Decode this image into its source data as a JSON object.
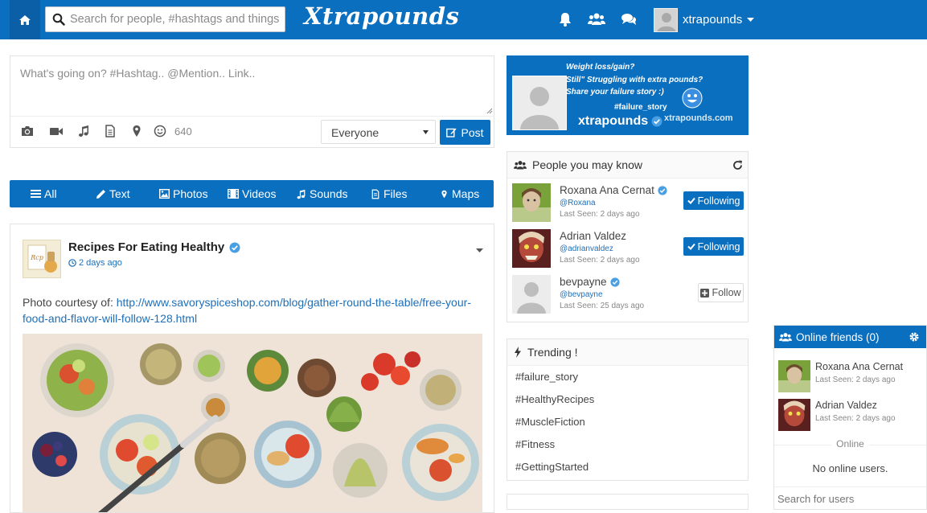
{
  "header": {
    "logo": "Xtrapounds",
    "search_placeholder": "Search for people, #hashtags and things",
    "username": "xtrapounds",
    "icons": [
      "home-icon",
      "search-icon",
      "bell-icon",
      "users-icon",
      "comments-icon",
      "caret-down-icon"
    ]
  },
  "composer": {
    "placeholder": "What's going on? #Hashtag.. @Mention.. Link..",
    "char_count": "640",
    "privacy": "Everyone",
    "post_label": "Post",
    "tools": [
      "camera-icon",
      "video-icon",
      "music-icon",
      "file-icon",
      "map-marker-icon",
      "smiley-icon"
    ]
  },
  "filters": [
    {
      "label": "All",
      "icon": "list-icon"
    },
    {
      "label": "Text",
      "icon": "pencil-icon"
    },
    {
      "label": "Photos",
      "icon": "picture-icon"
    },
    {
      "label": "Videos",
      "icon": "film-icon"
    },
    {
      "label": "Sounds",
      "icon": "music-icon"
    },
    {
      "label": "Files",
      "icon": "file-icon"
    },
    {
      "label": "Maps",
      "icon": "map-marker-icon"
    }
  ],
  "post": {
    "author": "Recipes For Eating Healthy",
    "time": "2 days ago",
    "text_prefix": "Photo courtesy of: ",
    "link": "http://www.savoryspiceshop.com/blog/gather-round-the-table/free-your-food-and-flavor-will-follow-128.html"
  },
  "promo": {
    "line1": "Weight loss/gain?",
    "line2": "Still\" Struggling with extra pounds?",
    "line3": "Share your failure story :)",
    "hashtag": "#failure_story",
    "domain": "xtrapounds.com",
    "name": "xtrapounds"
  },
  "people": {
    "title": "People you may know",
    "items": [
      {
        "name": "Roxana Ana Cernat",
        "handle": "@Roxana",
        "last_seen": "Last Seen: 2 days ago",
        "action": "Following"
      },
      {
        "name": "Adrian Valdez",
        "handle": "@adrianvaldez",
        "last_seen": "Last Seen: 2 days ago",
        "action": "Following"
      },
      {
        "name": "bevpayne",
        "handle": "@bevpayne",
        "last_seen": "Last Seen: 25 days ago",
        "action": "Follow"
      }
    ]
  },
  "trending": {
    "title": "Trending !",
    "tags": [
      "#failure_story",
      "#HealthyRecipes",
      "#MuscleFiction",
      "#Fitness",
      "#GettingStarted"
    ]
  },
  "online": {
    "title": "Online friends (0)",
    "friends": [
      {
        "name": "Roxana Ana Cernat",
        "last_seen": "Last Seen: 2 days ago"
      },
      {
        "name": "Adrian Valdez",
        "last_seen": "Last Seen: 2 days ago"
      }
    ],
    "online_label": "Online",
    "empty_text": "No online users.",
    "search_placeholder": "Search for users"
  },
  "colors": {
    "brand": "#0b6fbf",
    "link": "#1e6fb8",
    "verified": "#4a9fe3"
  }
}
